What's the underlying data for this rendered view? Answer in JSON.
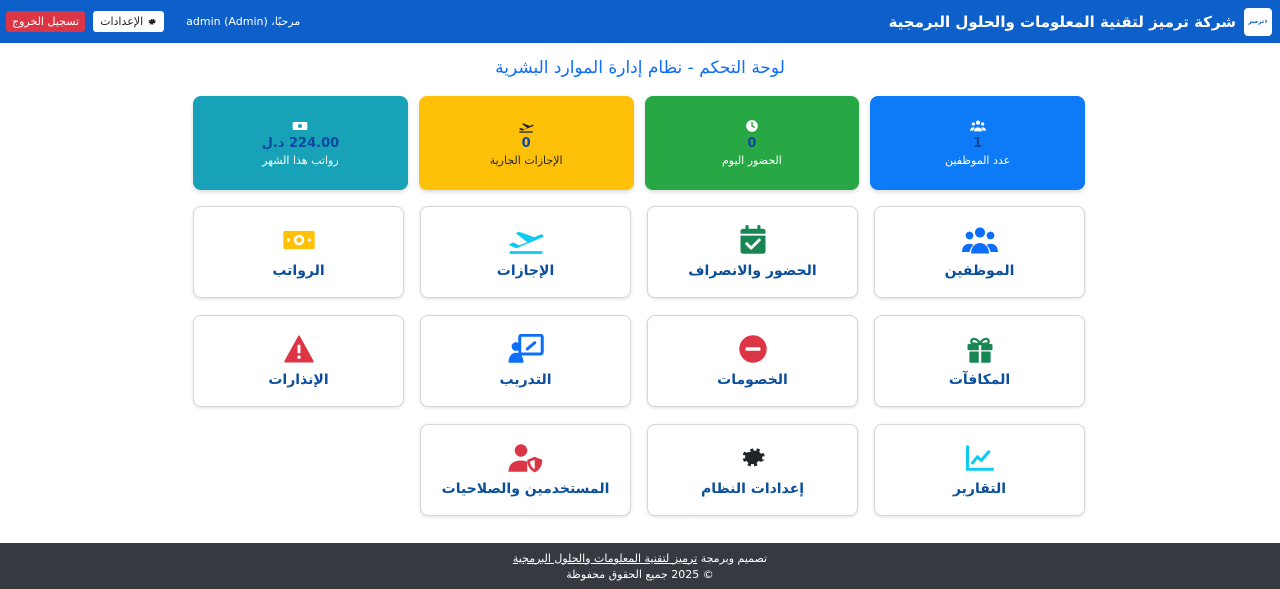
{
  "header": {
    "company": "شركة ترميز لتقنية المعلومات والحلول البرمجية",
    "logo_text": "ترميز",
    "welcome": "مرحبًا، admin (Admin)",
    "settings_label": "الإعدادات",
    "logout_label": "تسجيل الخروج"
  },
  "page_title": "لوحة التحكم - نظام إدارة الموارد البشرية",
  "stats": [
    {
      "value": "1",
      "label": "عدد الموظفين",
      "icon": "users-icon",
      "color": "#0d7bf7"
    },
    {
      "value": "0",
      "label": "الحضور اليوم",
      "icon": "clock-icon",
      "color": "#28a745"
    },
    {
      "value": "0",
      "label": "الإجازات الجارية",
      "icon": "plane-icon",
      "color": "#ffc107"
    },
    {
      "value": "224.00 د.ل",
      "label": "رواتب هذا الشهر",
      "icon": "money-icon",
      "color": "#17a2b8"
    }
  ],
  "modules": [
    {
      "label": "الموظفين",
      "icon": "users-icon",
      "color": "#0d6efd"
    },
    {
      "label": "الحضور والانصراف",
      "icon": "calendar-check-icon",
      "color": "#198754"
    },
    {
      "label": "الإجازات",
      "icon": "plane-icon",
      "color": "#0dcaf0"
    },
    {
      "label": "الرواتب",
      "icon": "money-icon",
      "color": "#ffc107"
    },
    {
      "label": "المكافآت",
      "icon": "gift-icon",
      "color": "#198754"
    },
    {
      "label": "الخصومات",
      "icon": "minus-circle-icon",
      "color": "#dc3545"
    },
    {
      "label": "التدريب",
      "icon": "training-icon",
      "color": "#0d6efd"
    },
    {
      "label": "الإنذارات",
      "icon": "warning-icon",
      "color": "#dc3545"
    },
    {
      "label": "التقارير",
      "icon": "chart-line-icon",
      "color": "#0dcaf0"
    },
    {
      "label": "إعدادات النظام",
      "icon": "gear-icon",
      "color": "#212529"
    },
    {
      "label": "المستخدمين والصلاحيات",
      "icon": "user-shield-icon",
      "color": "#dc3545"
    }
  ],
  "footer": {
    "prefix": "تصميم وبرمجة",
    "link": "ترميز لتقنية المعلومات والحلول البرمجية",
    "copyright": "© 2025 جميع الحقوق محفوظة"
  }
}
